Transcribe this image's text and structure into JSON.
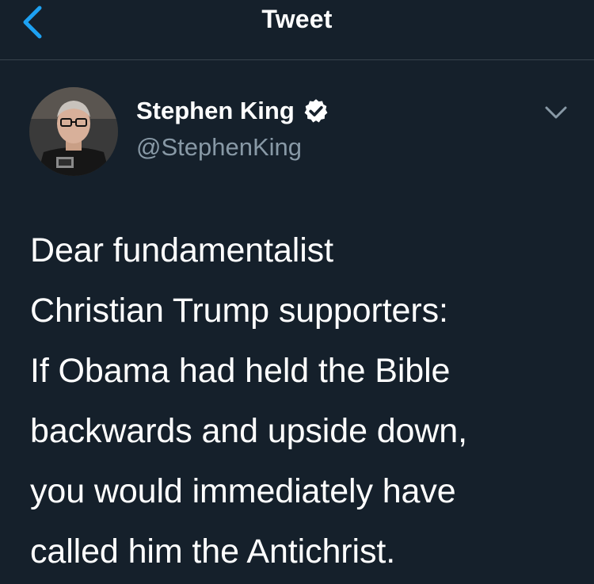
{
  "header": {
    "title": "Tweet",
    "back_icon": "chevron-left-icon",
    "accent_color": "#1da1f2"
  },
  "author": {
    "display_name": "Stephen King",
    "handle": "@StephenKing",
    "verified": true,
    "verified_icon": "verified-badge-icon",
    "menu_icon": "chevron-down-icon"
  },
  "tweet": {
    "text": "Dear fundamentalist\nChristian Trump supporters:\nIf Obama had held the Bible\nbackwards and upside down,\nyou would immediately have\ncalled him the Antichrist."
  },
  "theme": {
    "background": "#15202b",
    "divider": "#38444d",
    "secondary_text": "#8899a6"
  }
}
